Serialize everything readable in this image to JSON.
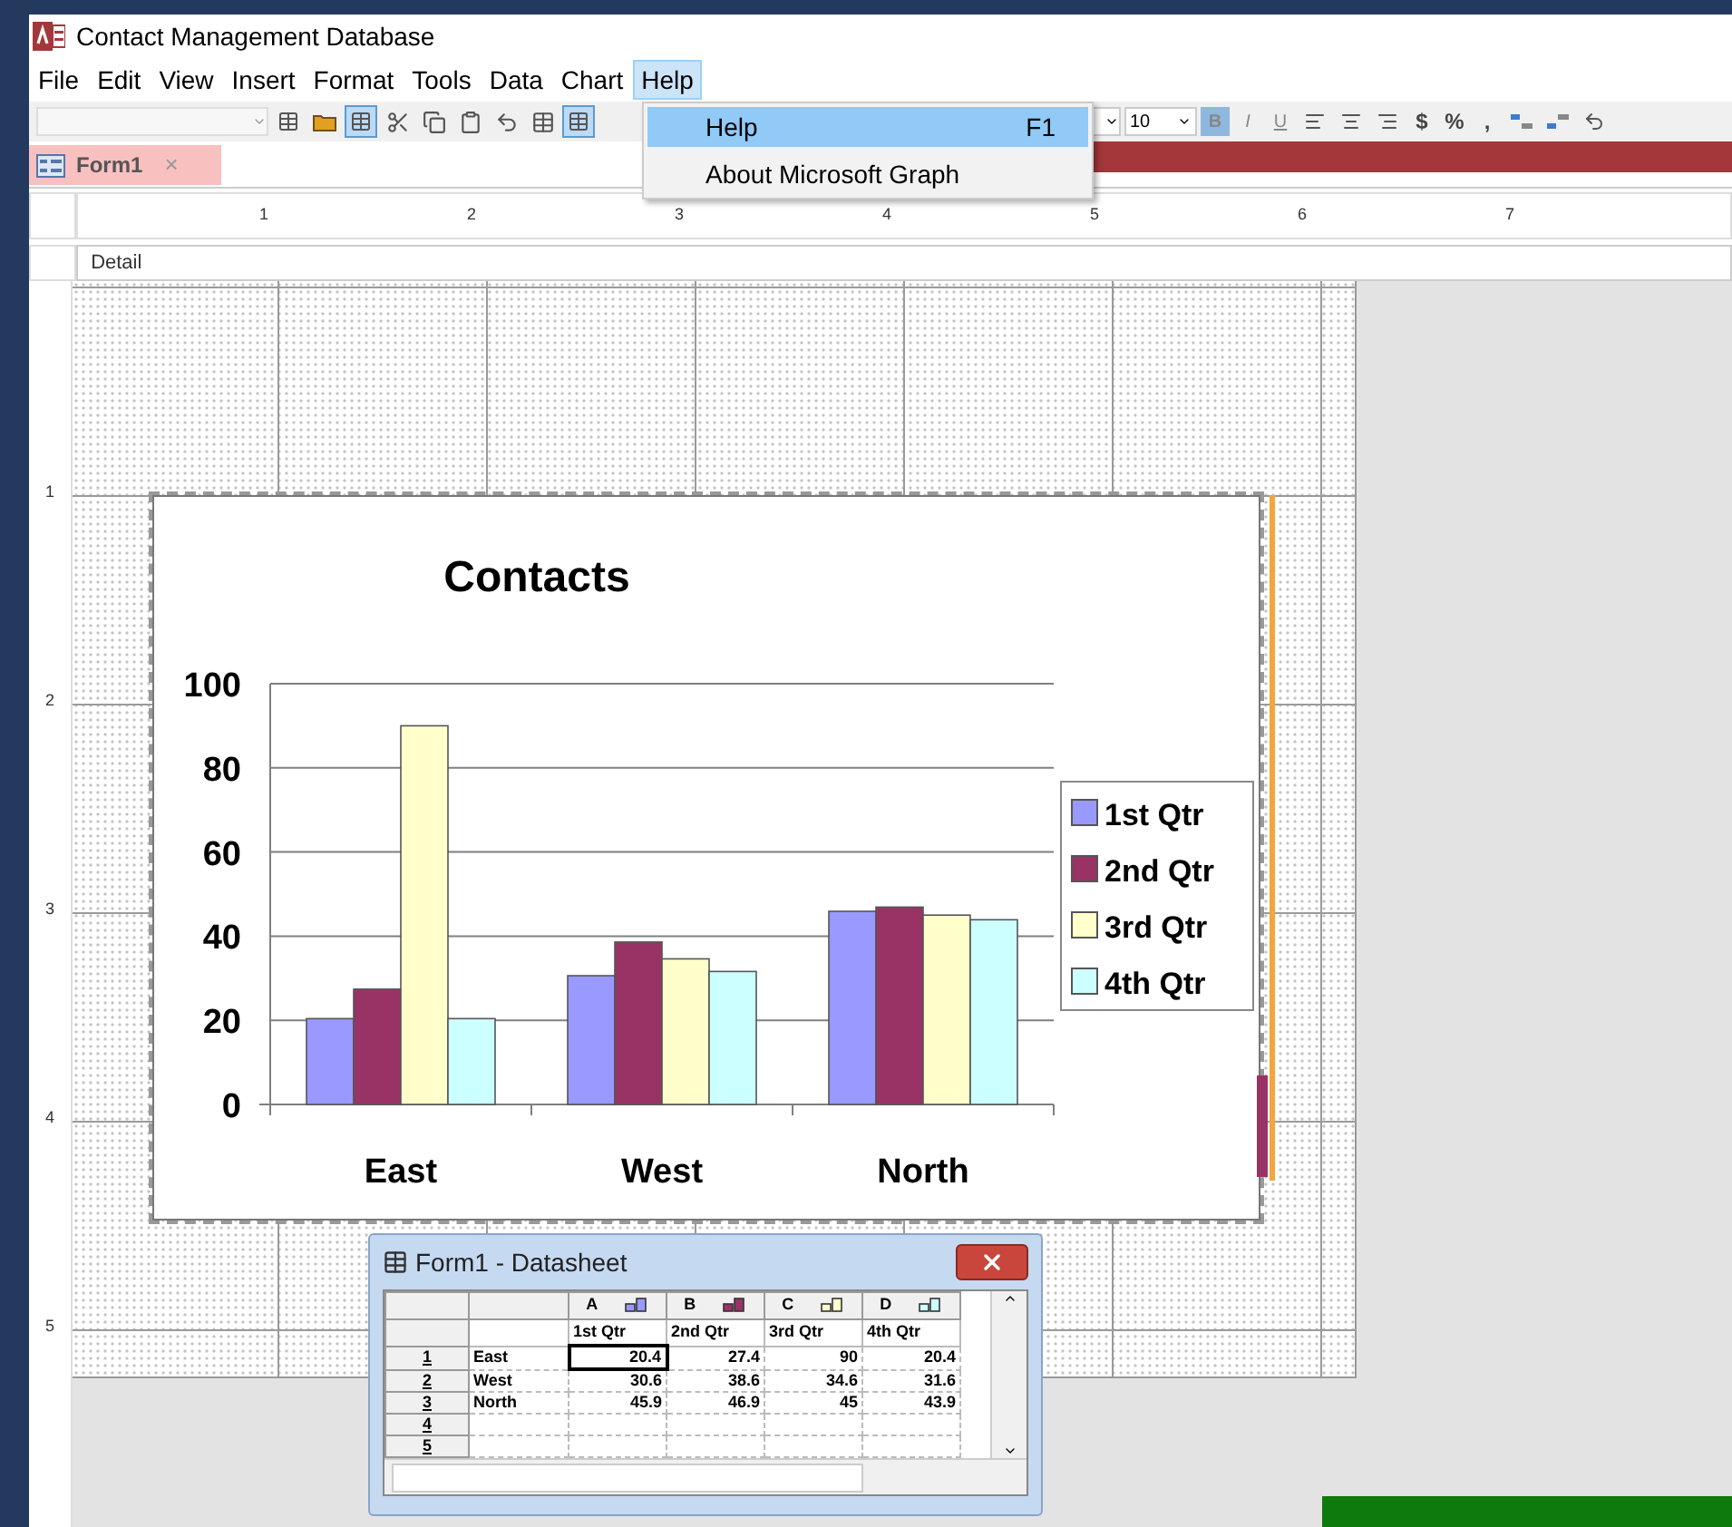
{
  "window": {
    "title": "Contact Management Database"
  },
  "menu": [
    {
      "label": "File",
      "selected": false
    },
    {
      "label": "Edit",
      "selected": false
    },
    {
      "label": "View",
      "selected": false
    },
    {
      "label": "Insert",
      "selected": false
    },
    {
      "label": "Format",
      "selected": false
    },
    {
      "label": "Tools",
      "selected": false
    },
    {
      "label": "Data",
      "selected": false
    },
    {
      "label": "Chart",
      "selected": false
    },
    {
      "label": "Help",
      "selected": true
    }
  ],
  "help_menu": {
    "items": [
      {
        "label": "Help",
        "shortcut": "F1",
        "selected": true
      },
      {
        "label": "About Microsoft Graph",
        "selected": false
      }
    ]
  },
  "toolbar": {
    "font_size": "10",
    "format_buttons": [
      {
        "label": "B",
        "selected": true
      },
      {
        "label": "I",
        "selected": false
      },
      {
        "label": "U",
        "selected": false
      }
    ],
    "number_buttons": [
      "$",
      "%",
      ","
    ]
  },
  "tab": {
    "label": "Form1",
    "close": "×"
  },
  "ruler": [
    "1",
    "2",
    "3",
    "4",
    "5",
    "6",
    "7"
  ],
  "vertical_ruler": [
    "1",
    "2",
    "3",
    "4",
    "5"
  ],
  "section": "Detail",
  "chart": {
    "chart_data": {
      "type": "bar",
      "title": "Contacts",
      "grid": true,
      "legend": true,
      "categories": [
        "East",
        "West",
        "North"
      ],
      "ylim": [
        0,
        100
      ],
      "yticks": [
        0,
        20,
        40,
        60,
        80,
        100
      ],
      "series": [
        {
          "name": "1st Qtr",
          "color": "#9999ff",
          "values": [
            20.4,
            30.6,
            45.9
          ]
        },
        {
          "name": "2nd Qtr",
          "color": "#993366",
          "values": [
            27.4,
            38.6,
            46.9
          ]
        },
        {
          "name": "3rd Qtr",
          "color": "#ffffcc",
          "values": [
            90,
            34.6,
            45
          ]
        },
        {
          "name": "4th Qtr",
          "color": "#ccffff",
          "values": [
            20.4,
            31.6,
            43.9
          ]
        }
      ]
    }
  },
  "datasheet": {
    "title": "Form1 - Datasheet",
    "columns": [
      {
        "letter": "A",
        "header": "1st Qtr",
        "color": "#9999ff"
      },
      {
        "letter": "B",
        "header": "2nd Qtr",
        "color": "#993366"
      },
      {
        "letter": "C",
        "header": "3rd Qtr",
        "color": "#ffffcc"
      },
      {
        "letter": "D",
        "header": "4th Qtr",
        "color": "#ccffff"
      }
    ],
    "rows": [
      {
        "number": "1",
        "label": "East",
        "cells": [
          {
            "value": "20.4",
            "selected": true
          },
          {
            "value": "27.4",
            "selected": false
          },
          {
            "value": "90",
            "selected": false
          },
          {
            "value": "20.4",
            "selected": false
          }
        ]
      },
      {
        "number": "2",
        "label": "West",
        "cells": [
          {
            "value": "30.6",
            "selected": false
          },
          {
            "value": "38.6",
            "selected": false
          },
          {
            "value": "34.6",
            "selected": false
          },
          {
            "value": "31.6",
            "selected": false
          }
        ]
      },
      {
        "number": "3",
        "label": "North",
        "cells": [
          {
            "value": "45.9",
            "selected": false
          },
          {
            "value": "46.9",
            "selected": false
          },
          {
            "value": "45",
            "selected": false
          },
          {
            "value": "43.9",
            "selected": false
          }
        ]
      },
      {
        "number": "4"
      },
      {
        "number": "5"
      }
    ]
  }
}
